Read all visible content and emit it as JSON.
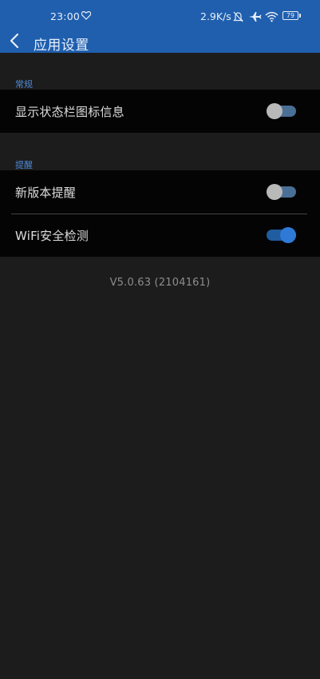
{
  "status_bar": {
    "time": "23:00",
    "net_speed": "2.9K/s",
    "battery": "79",
    "icons": [
      "heart-icon",
      "bell-off-icon",
      "airplane-icon",
      "wifi-icon",
      "battery-icon"
    ]
  },
  "header": {
    "title": "应用设置",
    "back_icon": "chevron-left-icon"
  },
  "sections": [
    {
      "title": "常规",
      "items": [
        {
          "label": "显示状态栏图标信息",
          "enabled": false
        }
      ]
    },
    {
      "title": "提醒",
      "items": [
        {
          "label": "新版本提醒",
          "enabled": false
        },
        {
          "label": "WiFi安全检测",
          "enabled": true
        }
      ]
    }
  ],
  "version": "V5.0.63 (2104161)",
  "colors": {
    "header": "#1f5fae",
    "background": "#1c1c1c",
    "panel": "#040404",
    "accent": "#4f8ad7",
    "toggle_on": "#2e7ad6",
    "toggle_off_thumb": "#b9b9b9",
    "toggle_track": "#4a6f95"
  }
}
